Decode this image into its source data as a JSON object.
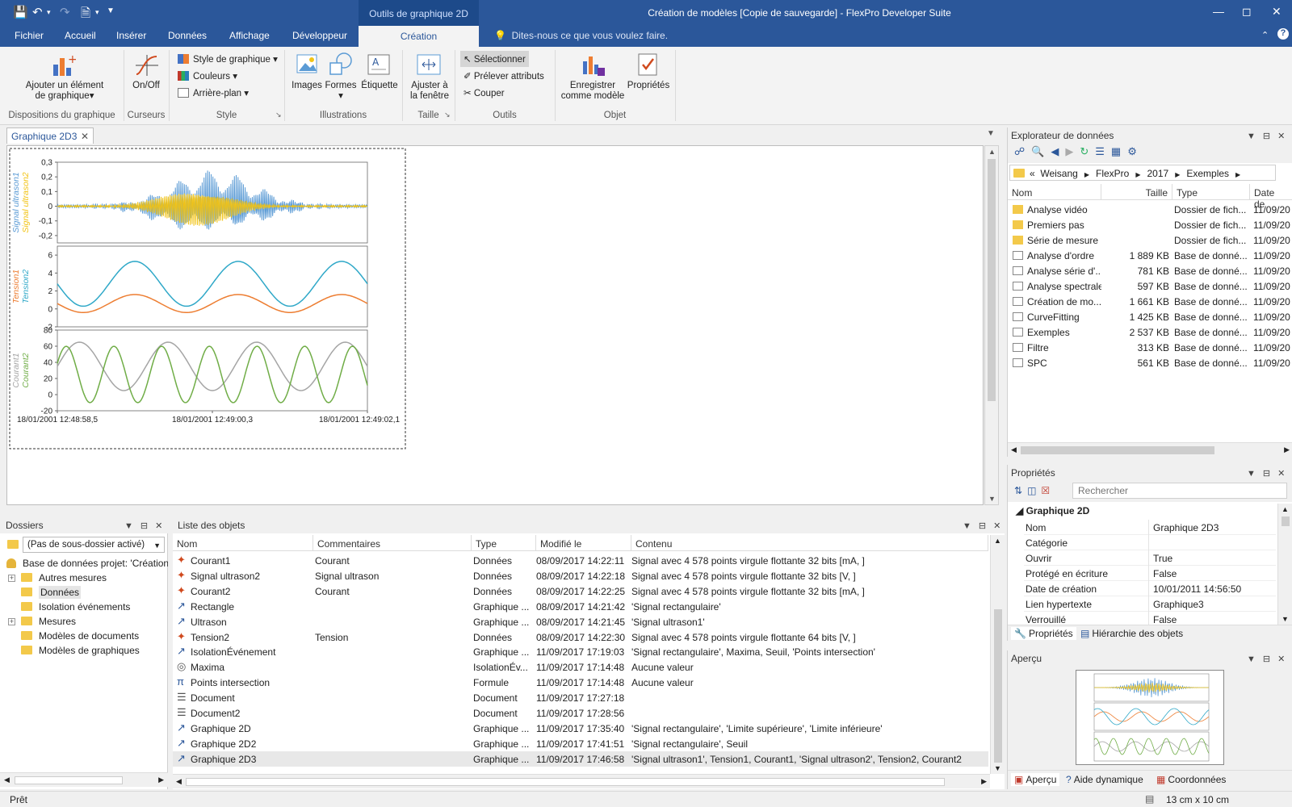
{
  "window": {
    "title": "Création de modèles [Copie de sauvegarde] - FlexPro Developer Suite",
    "context_group": "Outils de graphique 2D"
  },
  "menu_tabs": [
    "Fichier",
    "Accueil",
    "Insérer",
    "Données",
    "Affichage",
    "Développeur"
  ],
  "active_tab": "Création",
  "tellme": "Dites-nous ce que vous voulez faire.",
  "ribbon": {
    "groups": [
      "Dispositions du graphique",
      "Curseurs",
      "Style",
      "Illustrations",
      "Taille",
      "Outils",
      "Objet"
    ],
    "add_element": "Ajouter un élément",
    "add_element2": "de graphique",
    "onoff": "On/Off",
    "style_items": [
      "Style de graphique",
      "Couleurs",
      "Arrière-plan"
    ],
    "illus": [
      "Images",
      "Formes",
      "Étiquette"
    ],
    "fit1": "Ajuster à",
    "fit2": "la fenêtre",
    "tools": [
      "Sélectionner",
      "Prélever attributs",
      "Couper"
    ],
    "save1": "Enregistrer",
    "save2": "comme modèle",
    "props": "Propriétés"
  },
  "doc_tab": "Graphique 2D3",
  "chart_data": [
    {
      "type": "line",
      "title": "",
      "ylabel": [
        "Signal ultrason1",
        "Signal ultrason2"
      ],
      "yticks": [
        "0,3",
        "0,2",
        "0,1",
        "0",
        "-0,1",
        "-0,2"
      ],
      "ylim": [
        -0.25,
        0.3
      ],
      "series": [
        {
          "name": "Signal ultrason1",
          "color": "#5b9bd5"
        },
        {
          "name": "Signal ultrason2",
          "color": "#f2c314"
        }
      ]
    },
    {
      "type": "line",
      "ylabel": [
        "Tension1",
        "Tension2"
      ],
      "yticks": [
        "6",
        "4",
        "2",
        "0",
        "-2"
      ],
      "ylim": [
        -2,
        7
      ],
      "series": [
        {
          "name": "Tension1",
          "color": "#ed7d31",
          "amplitude": 1,
          "offset": 0.6,
          "periods": 3
        },
        {
          "name": "Tension2",
          "color": "#2fa8c8",
          "amplitude": 2.5,
          "offset": 2.8,
          "periods": 3
        }
      ]
    },
    {
      "type": "line",
      "ylabel": [
        "Courant1",
        "Courant2"
      ],
      "yticks": [
        "80",
        "60",
        "40",
        "20",
        "0",
        "-20"
      ],
      "ylim": [
        -20,
        80
      ],
      "series": [
        {
          "name": "Courant1",
          "color": "#a5a5a5",
          "amplitude": 30,
          "offset": 35,
          "periods": 3.5
        },
        {
          "name": "Courant2",
          "color": "#70ad47",
          "amplitude": 35,
          "offset": 25,
          "periods": 6.5
        }
      ],
      "xticks": [
        "18/01/2001 12:48:58,5",
        "18/01/2001 12:49:00,3",
        "18/01/2001 12:49:02,1"
      ]
    }
  ],
  "explorer": {
    "title": "Explorateur de données",
    "path": [
      "Weisang",
      "FlexPro",
      "2017",
      "Exemples"
    ],
    "columns": [
      "Nom",
      "Taille",
      "Type",
      "Date de"
    ],
    "rows": [
      {
        "name": "Analyse vidéo",
        "size": "",
        "type": "Dossier de fich...",
        "date": "11/09/20",
        "kind": "folder"
      },
      {
        "name": "Premiers pas",
        "size": "",
        "type": "Dossier de fich...",
        "date": "11/09/20",
        "kind": "folder"
      },
      {
        "name": "Série de mesure",
        "size": "",
        "type": "Dossier de fich...",
        "date": "11/09/20",
        "kind": "folder"
      },
      {
        "name": "Analyse d'ordre",
        "size": "1 889 KB",
        "type": "Base de donné...",
        "date": "11/09/20",
        "kind": "db"
      },
      {
        "name": "Analyse série d'...",
        "size": "781 KB",
        "type": "Base de donné...",
        "date": "11/09/20",
        "kind": "db"
      },
      {
        "name": "Analyse spectrale",
        "size": "597 KB",
        "type": "Base de donné...",
        "date": "11/09/20",
        "kind": "db"
      },
      {
        "name": "Création de mo...",
        "size": "1 661 KB",
        "type": "Base de donné...",
        "date": "11/09/20",
        "kind": "db"
      },
      {
        "name": "CurveFitting",
        "size": "1 425 KB",
        "type": "Base de donné...",
        "date": "11/09/20",
        "kind": "db"
      },
      {
        "name": "Exemples",
        "size": "2 537 KB",
        "type": "Base de donné...",
        "date": "11/09/20",
        "kind": "db"
      },
      {
        "name": "Filtre",
        "size": "313 KB",
        "type": "Base de donné...",
        "date": "11/09/20",
        "kind": "db"
      },
      {
        "name": "SPC",
        "size": "561 KB",
        "type": "Base de donné...",
        "date": "11/09/20",
        "kind": "db"
      }
    ]
  },
  "properties": {
    "title": "Propriétés",
    "search_placeholder": "Rechercher",
    "section": "Graphique 2D",
    "rows": [
      [
        "Nom",
        "Graphique 2D3"
      ],
      [
        "Catégorie",
        ""
      ],
      [
        "Ouvrir",
        "True"
      ],
      [
        "Protégé en écriture",
        "False"
      ],
      [
        "Date de création",
        "10/01/2011 14:56:50"
      ],
      [
        "Lien hypertexte",
        "Graphique3"
      ],
      [
        "Verrouillé",
        "False"
      ]
    ],
    "tabs": [
      "Propriétés",
      "Hiérarchie des objets"
    ]
  },
  "preview": {
    "title": "Aperçu",
    "tabs": [
      "Aperçu",
      "Aide dynamique",
      "Coordonnées"
    ]
  },
  "folders": {
    "title": "Dossiers",
    "filter": "(Pas de sous-dossier activé)",
    "root": "Base de données projet: 'Création d",
    "items": [
      {
        "label": "Autres mesures",
        "expand": true
      },
      {
        "label": "Données",
        "expand": false,
        "selected": true
      },
      {
        "label": "Isolation événements",
        "expand": false
      },
      {
        "label": "Mesures",
        "expand": true
      },
      {
        "label": "Modèles de documents",
        "expand": false
      },
      {
        "label": "Modèles de graphiques",
        "expand": false
      }
    ]
  },
  "objects": {
    "title": "Liste des objets",
    "columns": [
      "Nom",
      "Commentaires",
      "Type",
      "Modifié le",
      "Contenu"
    ],
    "rows": [
      [
        "Courant1",
        "Courant",
        "Données",
        "08/09/2017 14:22:11",
        "Signal avec 4 578 points virgule flottante 32 bits [mA, ]",
        "data"
      ],
      [
        "Signal ultrason2",
        "Signal ultrason",
        "Données",
        "08/09/2017 14:22:18",
        "Signal avec 4 578 points virgule flottante 32 bits [V, ]",
        "data"
      ],
      [
        "Courant2",
        "Courant",
        "Données",
        "08/09/2017 14:22:25",
        "Signal avec 4 578 points virgule flottante 32 bits [mA, ]",
        "data"
      ],
      [
        "Rectangle",
        "",
        "Graphique ...",
        "08/09/2017 14:21:42",
        "'Signal rectangulaire'",
        "graph"
      ],
      [
        "Ultrason",
        "",
        "Graphique ...",
        "08/09/2017 14:21:45",
        "'Signal ultrason1'",
        "graph"
      ],
      [
        "Tension2",
        "Tension",
        "Données",
        "08/09/2017 14:22:30",
        "Signal avec 4 578 points virgule flottante 64 bits [V, ]",
        "data"
      ],
      [
        "IsolationÉvénement",
        "",
        "Graphique ...",
        "11/09/2017 17:19:03",
        "'Signal rectangulaire', Maxima, Seuil, 'Points intersection'",
        "graph"
      ],
      [
        "Maxima",
        "",
        "IsolationÉv...",
        "11/09/2017 17:14:48",
        "Aucune valeur",
        "iso"
      ],
      [
        "Points intersection",
        "",
        "Formule",
        "11/09/2017 17:14:48",
        "Aucune valeur",
        "formula"
      ],
      [
        "Document",
        "",
        "Document",
        "11/09/2017 17:27:18",
        "",
        "doc"
      ],
      [
        "Document2",
        "",
        "Document",
        "11/09/2017 17:28:56",
        "",
        "doc"
      ],
      [
        "Graphique 2D",
        "",
        "Graphique ...",
        "11/09/2017 17:35:40",
        "'Signal rectangulaire', 'Limite supérieure', 'Limite inférieure'",
        "graph"
      ],
      [
        "Graphique 2D2",
        "",
        "Graphique ...",
        "11/09/2017 17:41:51",
        "'Signal rectangulaire', Seuil",
        "graph"
      ],
      [
        "Graphique 2D3",
        "",
        "Graphique ...",
        "11/09/2017 17:46:58",
        "'Signal ultrason1', Tension1, Courant1, 'Signal ultrason2', Tension2, Courant2",
        "graph"
      ]
    ]
  },
  "status": {
    "left": "Prêt",
    "right": "13 cm x 10 cm"
  }
}
